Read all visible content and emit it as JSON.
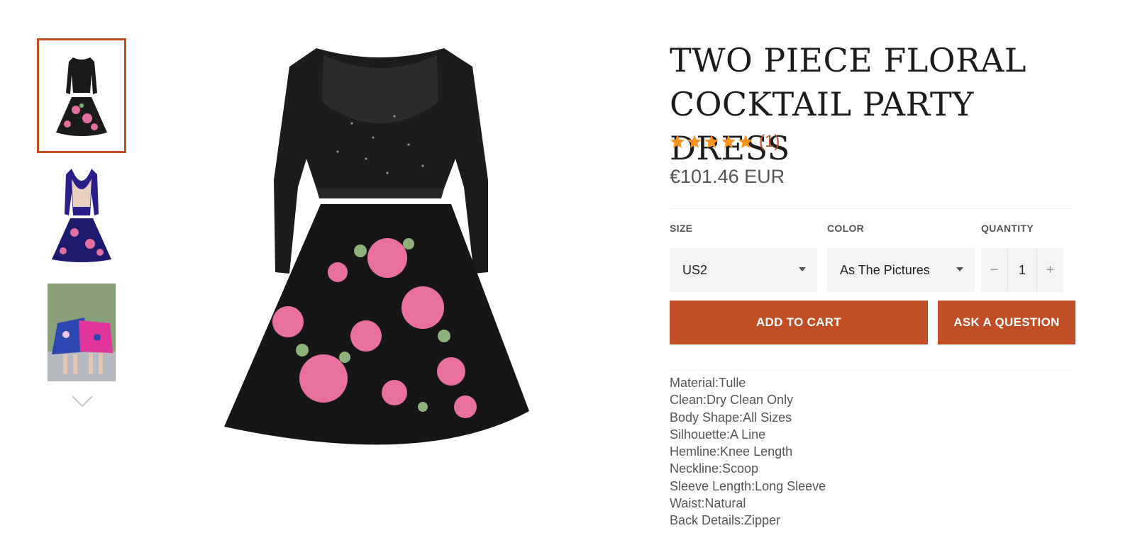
{
  "product": {
    "title_line1": "TWO PIECE FLORAL",
    "title_line2": "COCKTAIL PARTY DRESS",
    "rating": 5,
    "review_count": "(1)",
    "price": "€101.46 EUR"
  },
  "options": {
    "size_label": "SIZE",
    "size_value": "US2",
    "color_label": "COLOR",
    "color_value": "As The Pictures",
    "quantity_label": "QUANTITY",
    "quantity_value": "1",
    "minus_symbol": "−",
    "plus_symbol": "+"
  },
  "buttons": {
    "add_to_cart": "ADD TO CART",
    "ask_question": "ASK A QUESTION"
  },
  "details": [
    "Material:Tulle",
    "Clean:Dry Clean Only",
    "Body Shape:All Sizes",
    "Silhouette:A Line",
    "Hemline:Knee Length",
    "Neckline:Scoop",
    "Sleeve Length:Long Sleeve",
    "Waist:Natural",
    "Back Details:Zipper"
  ],
  "colors": {
    "accent": "#c04d24",
    "star": "#f7931e",
    "text": "#555555",
    "title": "#1c1c1c",
    "field_bg": "#f3f3f3"
  },
  "icons": {
    "thumbnails_next": "chevron-down-icon",
    "rating": "star-icon"
  }
}
